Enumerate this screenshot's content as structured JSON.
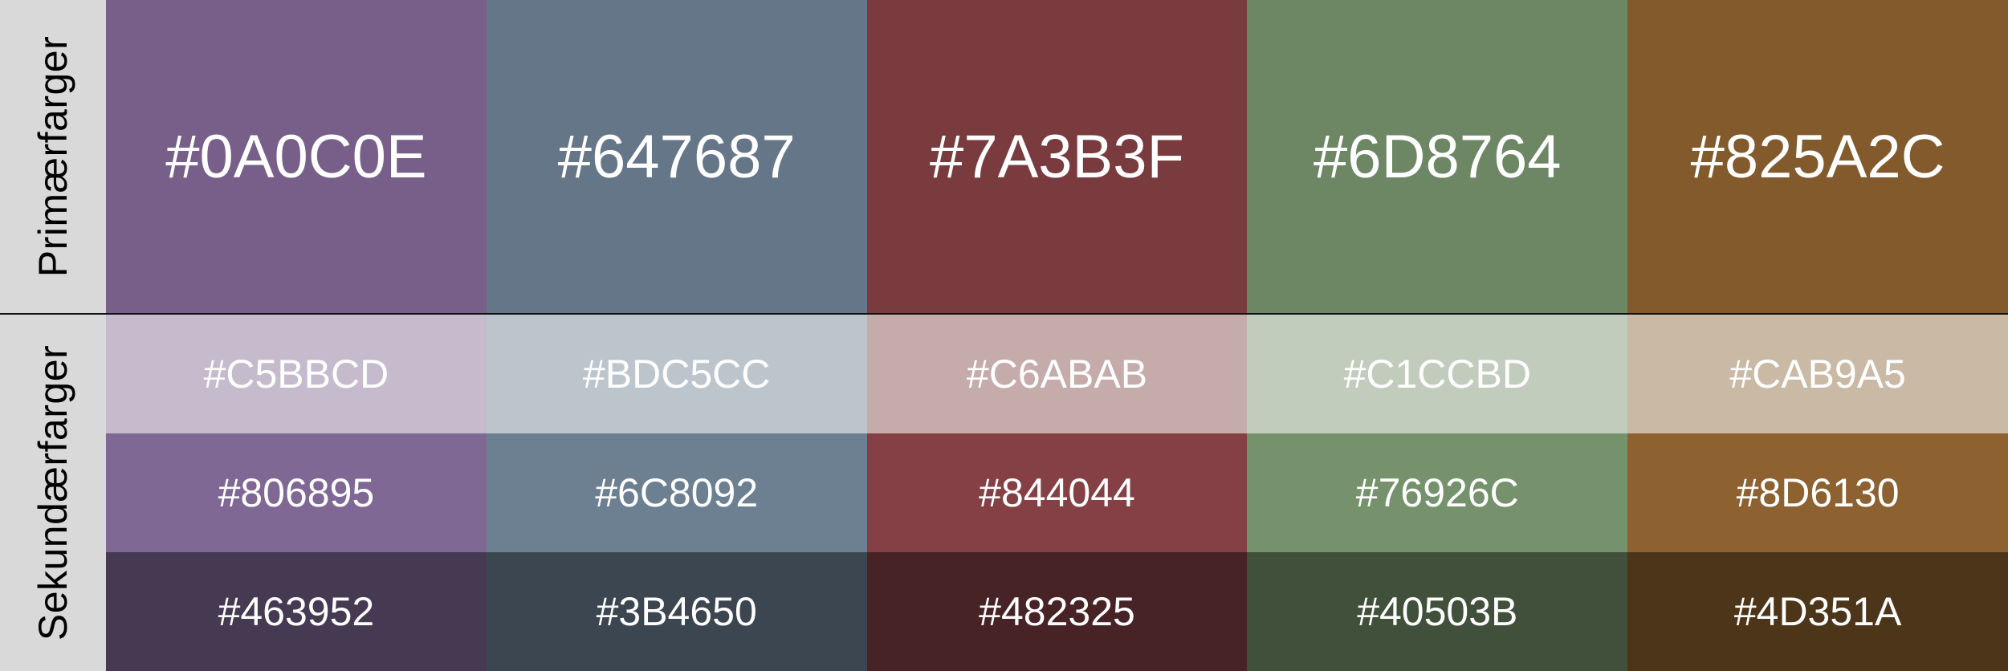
{
  "labels": {
    "primary": "Primærfarger",
    "secondary": "Sekundærfarger"
  },
  "primary": [
    {
      "text": "#0A0C0E",
      "color": "#775F8A"
    },
    {
      "text": "#647687",
      "color": "#647687"
    },
    {
      "text": "#7A3B3F",
      "color": "#7A3B3F"
    },
    {
      "text": "#6D8764",
      "color": "#6D8764"
    },
    {
      "text": "#825A2C",
      "color": "#825A2C"
    }
  ],
  "secondary": [
    [
      {
        "text": "#C5BBCD",
        "color": "#C5BBCD"
      },
      {
        "text": "#BDC5CC",
        "color": "#BDC5CC"
      },
      {
        "text": "#C6ABAB",
        "color": "#C6ABAB"
      },
      {
        "text": "#C1CCBD",
        "color": "#C1CCBD"
      },
      {
        "text": "#CAB9A5",
        "color": "#CAB9A5"
      }
    ],
    [
      {
        "text": "#806895",
        "color": "#806895"
      },
      {
        "text": "#6C8092",
        "color": "#6C8092"
      },
      {
        "text": "#844044",
        "color": "#844044"
      },
      {
        "text": "#76926C",
        "color": "#76926C"
      },
      {
        "text": "#8D6130",
        "color": "#8D6130"
      }
    ],
    [
      {
        "text": "#463952",
        "color": "#463952"
      },
      {
        "text": "#3B4650",
        "color": "#3B4650"
      },
      {
        "text": "#482325",
        "color": "#482325"
      },
      {
        "text": "#40503B",
        "color": "#40503B"
      },
      {
        "text": "#4D351A",
        "color": "#4D351A"
      }
    ]
  ]
}
